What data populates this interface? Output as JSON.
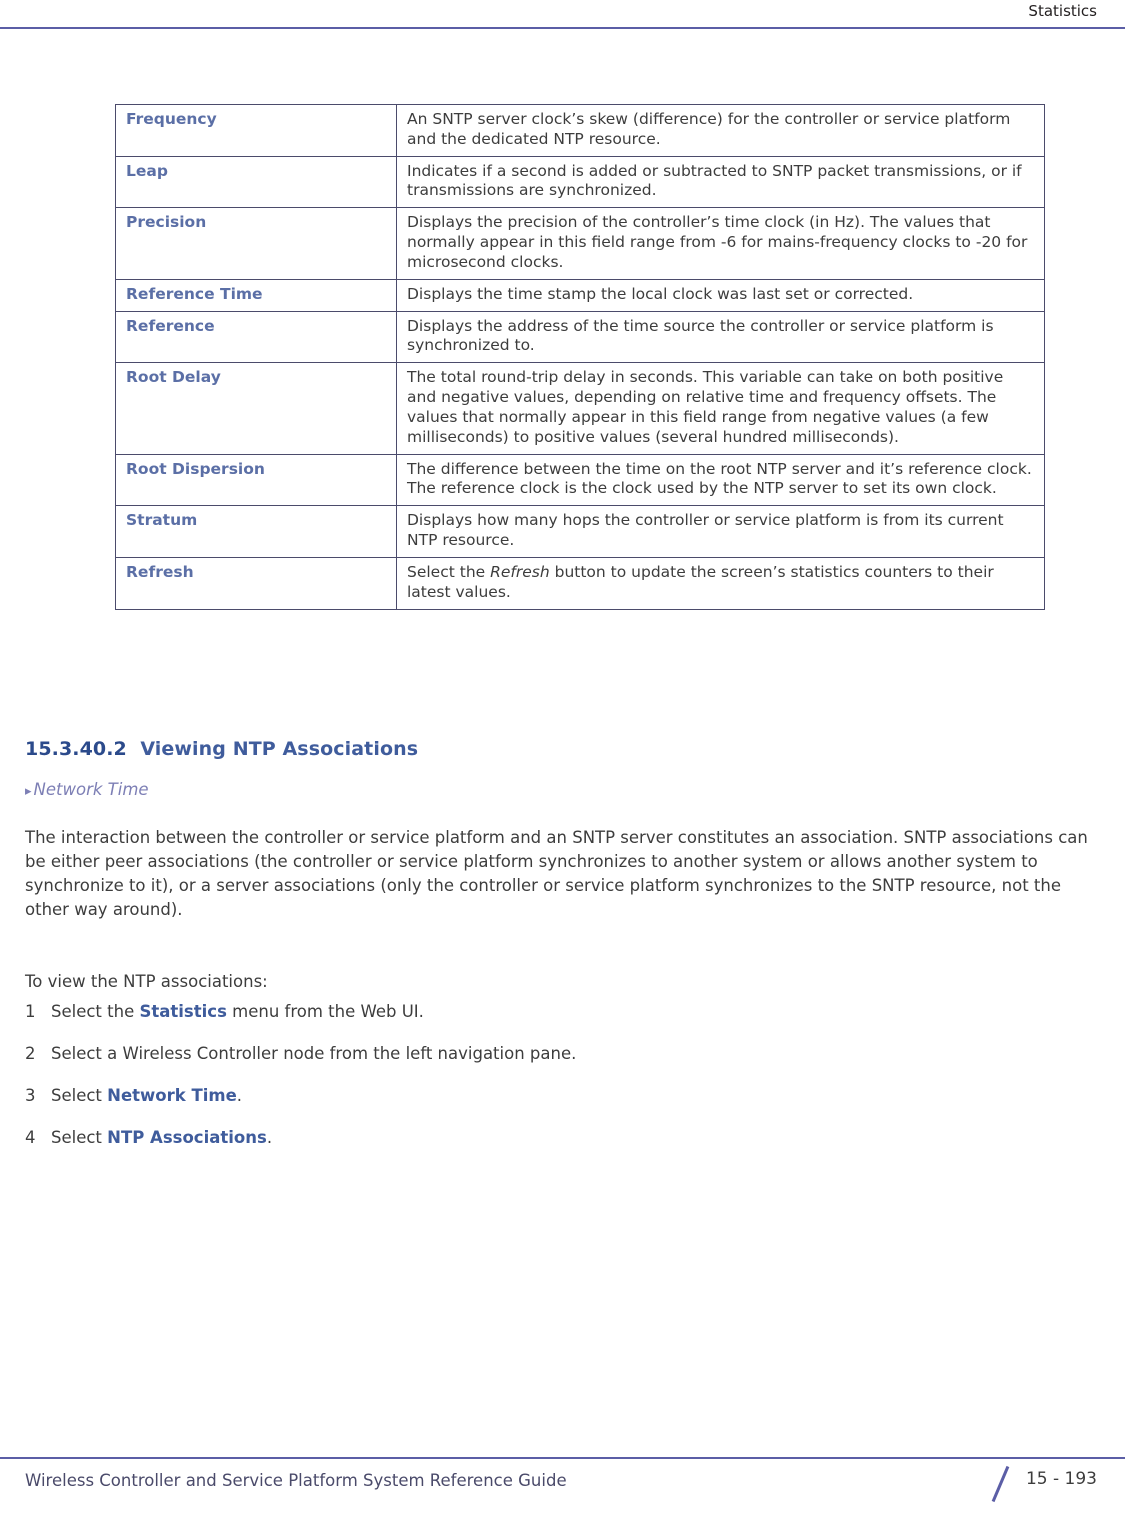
{
  "header": {
    "title": "Statistics"
  },
  "table": {
    "rows": [
      {
        "key": "Frequency",
        "value": "An SNTP server clock’s skew (difference) for the controller or service platform and the dedicated NTP resource."
      },
      {
        "key": "Leap",
        "value": "Indicates if a second is added or subtracted to SNTP packet transmissions, or if transmissions are synchronized."
      },
      {
        "key": "Precision",
        "value": "Displays the precision of the controller’s time clock (in Hz). The values that normally appear in this field range from -6 for mains-frequency clocks to -20 for microsecond clocks."
      },
      {
        "key": "Reference Time",
        "value": "Displays the time stamp the local clock was last set or corrected."
      },
      {
        "key": "Reference",
        "value": "Displays the address of the time source the controller or service platform is synchronized to."
      },
      {
        "key": "Root Delay",
        "value": "The total round-trip delay in seconds. This variable can take on both positive and negative values, depending on relative time and frequency offsets. The values that normally appear in this field range from negative values (a few milliseconds) to positive values (several hundred milliseconds)."
      },
      {
        "key": "Root Dispersion",
        "value": "The difference between the time on the root NTP server and it’s reference clock. The reference clock is the clock used by the NTP server to set its own clock."
      },
      {
        "key": "Stratum",
        "value": "Displays how many hops the controller or service platform is from its current NTP resource."
      },
      {
        "key": "Refresh",
        "value_parts": {
          "before": "Select the ",
          "italic": "Refresh",
          "after": " button to update the screen’s statistics counters to their latest values."
        }
      }
    ]
  },
  "section": {
    "number": "15.3.40.2",
    "title": "Viewing NTP Associations",
    "crossref": "Network Time"
  },
  "body": {
    "paragraph1": "The interaction between the controller or service platform and an SNTP server constitutes an association. SNTP associations can be either peer associations (the controller or service platform synchronizes to another system or allows another system to synchronize to it), or a server associations (only the controller or service platform synchronizes to the SNTP resource, not the other way around).",
    "paragraph2": "To view the NTP associations:",
    "steps": [
      {
        "num": "1",
        "before": "Select the ",
        "bold": "Statistics",
        "after": " menu from the Web UI."
      },
      {
        "num": "2",
        "before": "Select a Wireless Controller node from the left navigation pane.",
        "bold": "",
        "after": ""
      },
      {
        "num": "3",
        "before": "Select ",
        "bold": "Network Time",
        "after": "."
      },
      {
        "num": "4",
        "before": "Select ",
        "bold": "NTP Associations",
        "after": "."
      }
    ]
  },
  "footer": {
    "guide": "Wireless Controller and Service Platform System Reference Guide",
    "page": "15 - 193"
  }
}
